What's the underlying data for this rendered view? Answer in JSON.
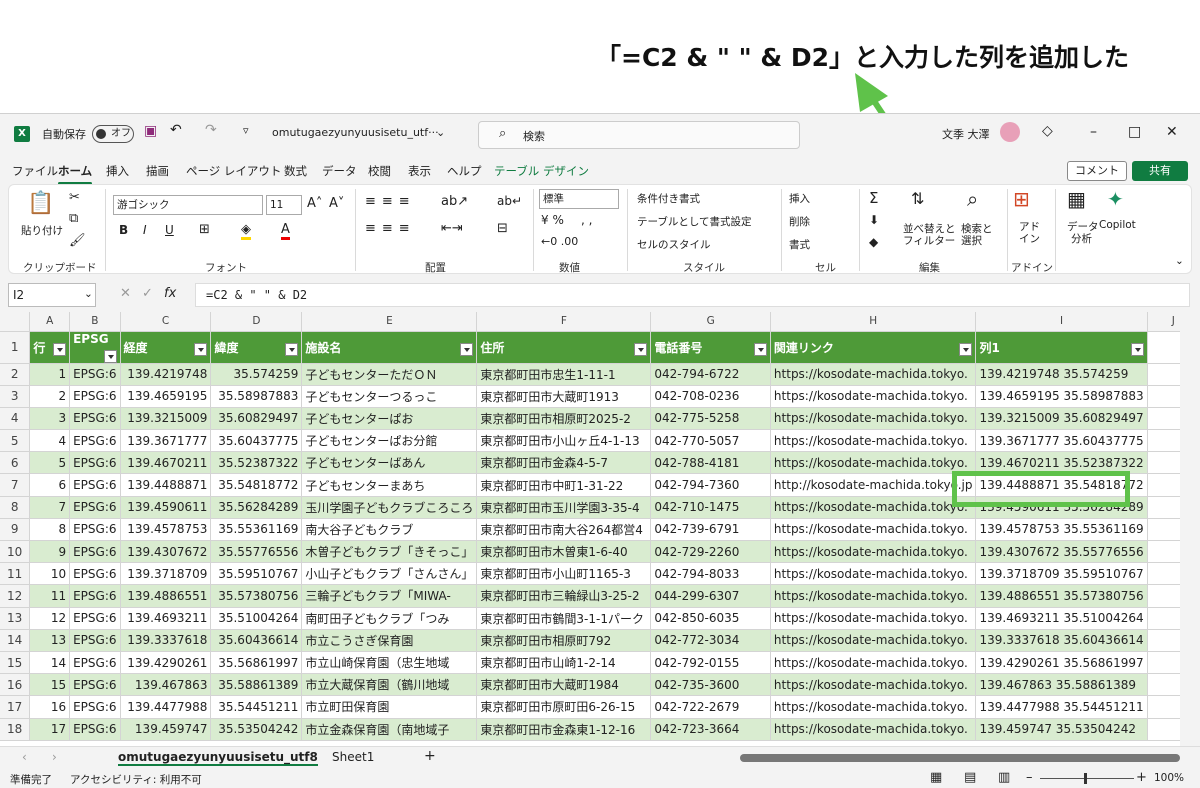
{
  "annotation": "「=C2 & \" \" & D2」と入力した列を追加した",
  "titlebar": {
    "autosave_label": "自動保存",
    "autosave_state": "オフ",
    "filename": "omutugaezyunyuusisetu_utf···",
    "search_placeholder": "検索",
    "user_name": "文季 大澤"
  },
  "tabs": [
    "ファイル",
    "ホーム",
    "挿入",
    "描画",
    "ページ レイアウト",
    "数式",
    "データ",
    "校閲",
    "表示",
    "ヘルプ",
    "テーブル デザイン"
  ],
  "comment_label": "コメント",
  "share_label": "共有",
  "ribbon": {
    "paste": "貼り付け",
    "clipboard": "クリップボード",
    "font_name": "游ゴシック",
    "font_size": "11",
    "font": "フォント",
    "alignment": "配置",
    "number_format": "標準",
    "number": "数値",
    "cond_format": "条件付き書式",
    "table_format": "テーブルとして書式設定",
    "cell_style": "セルのスタイル",
    "styles": "スタイル",
    "insert": "挿入",
    "delete": "削除",
    "format": "書式",
    "cells": "セル",
    "sort_filter_1": "並べ替えと",
    "sort_filter_2": "フィルター",
    "find_1": "検索と",
    "find_2": "選択",
    "editing": "編集",
    "addin_1": "アド",
    "addin_2": "イン",
    "addins": "アドイン",
    "analysis_1": "データ",
    "analysis_2": "分析",
    "copilot": "Copilot"
  },
  "formula_bar": {
    "namebox": "I2",
    "formula": "=C2 & \" \" & D2"
  },
  "columns": [
    "A",
    "B",
    "C",
    "D",
    "E",
    "F",
    "G",
    "H",
    "I",
    "J"
  ],
  "headers": [
    "行",
    "EPSG",
    "経度",
    "緯度",
    "施設名",
    "住所",
    "電話番号",
    "関連リンク",
    "列1"
  ],
  "rows": [
    [
      "1",
      "EPSG:6",
      "139.4219748",
      "35.574259",
      "子どもセンターただＯＮ",
      "東京都町田市忠生1-11-1",
      "042-794-6722",
      "https://kosodate-machida.tokyo.",
      "139.4219748 35.574259"
    ],
    [
      "2",
      "EPSG:6",
      "139.4659195",
      "35.58987883",
      "子どもセンターつるっこ",
      "東京都町田市大蔵町1913",
      "042-708-0236",
      "https://kosodate-machida.tokyo.",
      "139.4659195 35.58987883"
    ],
    [
      "3",
      "EPSG:6",
      "139.3215009",
      "35.60829497",
      "子どもセンターぱお",
      "東京都町田市相原町2025-2",
      "042-775-5258",
      "https://kosodate-machida.tokyo.",
      "139.3215009 35.60829497"
    ],
    [
      "4",
      "EPSG:6",
      "139.3671777",
      "35.60437775",
      "子どもセンターぱお分館",
      "東京都町田市小山ヶ丘4-1-13",
      "042-770-5057",
      "https://kosodate-machida.tokyo.",
      "139.3671777 35.60437775"
    ],
    [
      "5",
      "EPSG:6",
      "139.4670211",
      "35.52387322",
      "子どもセンターばあん",
      "東京都町田市金森4-5-7",
      "042-788-4181",
      "https://kosodate-machida.tokyo.",
      "139.4670211 35.52387322"
    ],
    [
      "6",
      "EPSG:6",
      "139.4488871",
      "35.54818772",
      "子どもセンターまあち",
      "東京都町田市中町1-31-22",
      "042-794-7360",
      "http://kosodate-machida.tokyo.jp",
      "139.4488871 35.54818772"
    ],
    [
      "7",
      "EPSG:6",
      "139.4590611",
      "35.56284289",
      "玉川学園子どもクラブころころ",
      "東京都町田市玉川学園3-35-4",
      "042-710-1475",
      "https://kosodate-machida.tokyo.",
      "139.4590611 35.56284289"
    ],
    [
      "8",
      "EPSG:6",
      "139.4578753",
      "35.55361169",
      "南大谷子どもクラブ",
      "東京都町田市南大谷264都営4",
      "042-739-6791",
      "https://kosodate-machida.tokyo.",
      "139.4578753 35.55361169"
    ],
    [
      "9",
      "EPSG:6",
      "139.4307672",
      "35.55776556",
      "木曽子どもクラブ「きそっこ」",
      "東京都町田市木曽東1-6-40",
      "042-729-2260",
      "https://kosodate-machida.tokyo.",
      "139.4307672 35.55776556"
    ],
    [
      "10",
      "EPSG:6",
      "139.3718709",
      "35.59510767",
      "小山子どもクラブ「さんさん」",
      "東京都町田市小山町1165-3",
      "042-794-8033",
      "https://kosodate-machida.tokyo.",
      "139.3718709 35.59510767"
    ],
    [
      "11",
      "EPSG:6",
      "139.4886551",
      "35.57380756",
      "三輪子どもクラブ「MIWA-",
      "東京都町田市三輪緑山3-25-2",
      "044-299-6307",
      "https://kosodate-machida.tokyo.",
      "139.4886551 35.57380756"
    ],
    [
      "12",
      "EPSG:6",
      "139.4693211",
      "35.51004264",
      "南町田子どもクラブ「つみ",
      "東京都町田市鶴間3-1-1パーク",
      "042-850-6035",
      "https://kosodate-machida.tokyo.",
      "139.4693211 35.51004264"
    ],
    [
      "13",
      "EPSG:6",
      "139.3337618",
      "35.60436614",
      "市立こうさぎ保育園",
      "東京都町田市相原町792",
      "042-772-3034",
      "https://kosodate-machida.tokyo.",
      "139.3337618 35.60436614"
    ],
    [
      "14",
      "EPSG:6",
      "139.4290261",
      "35.56861997",
      "市立山崎保育園（忠生地域",
      "東京都町田市山崎1-2-14",
      "042-792-0155",
      "https://kosodate-machida.tokyo.",
      "139.4290261 35.56861997"
    ],
    [
      "15",
      "EPSG:6",
      "139.467863",
      "35.58861389",
      "市立大蔵保育園（鶴川地域",
      "東京都町田市大蔵町1984",
      "042-735-3600",
      "https://kosodate-machida.tokyo.",
      "139.467863 35.58861389"
    ],
    [
      "16",
      "EPSG:6",
      "139.4477988",
      "35.54451211",
      "市立町田保育園",
      "東京都町田市原町田6-26-15",
      "042-722-2679",
      "https://kosodate-machida.tokyo.",
      "139.4477988 35.54451211"
    ],
    [
      "17",
      "EPSG:6",
      "139.459747",
      "35.53504242",
      "市立金森保育園（南地域子",
      "東京都町田市金森東1-12-16",
      "042-723-3664",
      "https://kosodate-machida.tokyo.",
      "139.459747 35.53504242"
    ]
  ],
  "sheet_tabs": [
    "omutugaezyunyuusisetu_utf8",
    "Sheet1"
  ],
  "status": {
    "ready": "準備完了",
    "accessibility": "アクセシビリティ: 利用不可",
    "zoom": "100%"
  }
}
